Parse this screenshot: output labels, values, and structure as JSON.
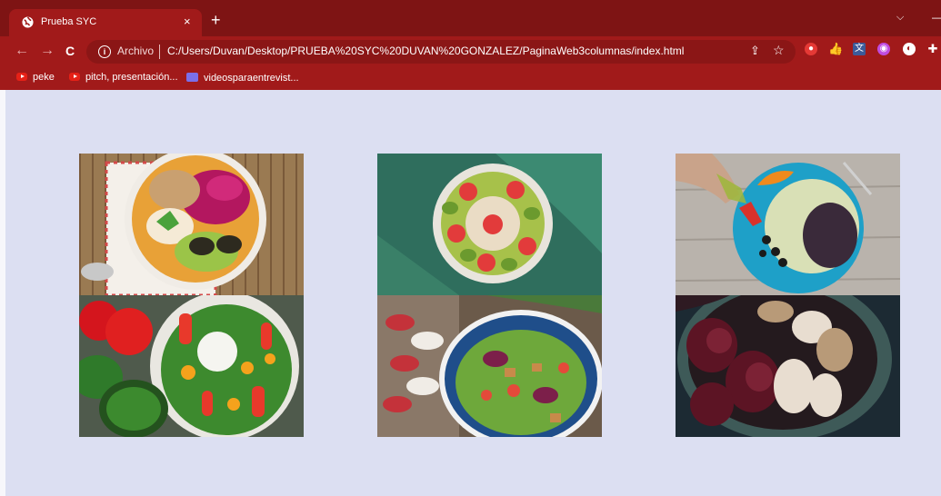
{
  "browser": {
    "tab_title": "Prueba SYC",
    "tab_close": "×",
    "new_tab": "+",
    "tab_menu": "⌵",
    "window_minimize": "—",
    "nav": {
      "back": "←",
      "forward": "→",
      "reload": "C"
    },
    "address": {
      "security_label": "Archivo",
      "url": "C:/Users/Duvan/Desktop/PRUEBA%20SYC%20DUVAN%20GONZALEZ/PaginaWeb3columnas/index.html"
    },
    "bookmarks": [
      {
        "label": "peke",
        "icon": "youtube-icon"
      },
      {
        "label": "pitch, presentación...",
        "icon": "youtube-icon"
      },
      {
        "label": "videosparaentrevist...",
        "icon": "video-folder-icon"
      }
    ]
  },
  "page": {
    "background": "#dcdff2",
    "gallery": [
      {
        "name": "acai-bowl-avocado",
        "column": 1,
        "row": 1
      },
      {
        "name": "kiwi-strawberry-smoothie-bowl",
        "column": 2,
        "row": 1
      },
      {
        "name": "salad-plate-olive-oil",
        "column": 3,
        "row": 1
      },
      {
        "name": "burrata-vegetable-salad",
        "column": 1,
        "row": 2
      },
      {
        "name": "green-salad-bowl",
        "column": 2,
        "row": 2
      },
      {
        "name": "roasted-beet-mushroom-bowl",
        "column": 3,
        "row": 2
      }
    ]
  }
}
